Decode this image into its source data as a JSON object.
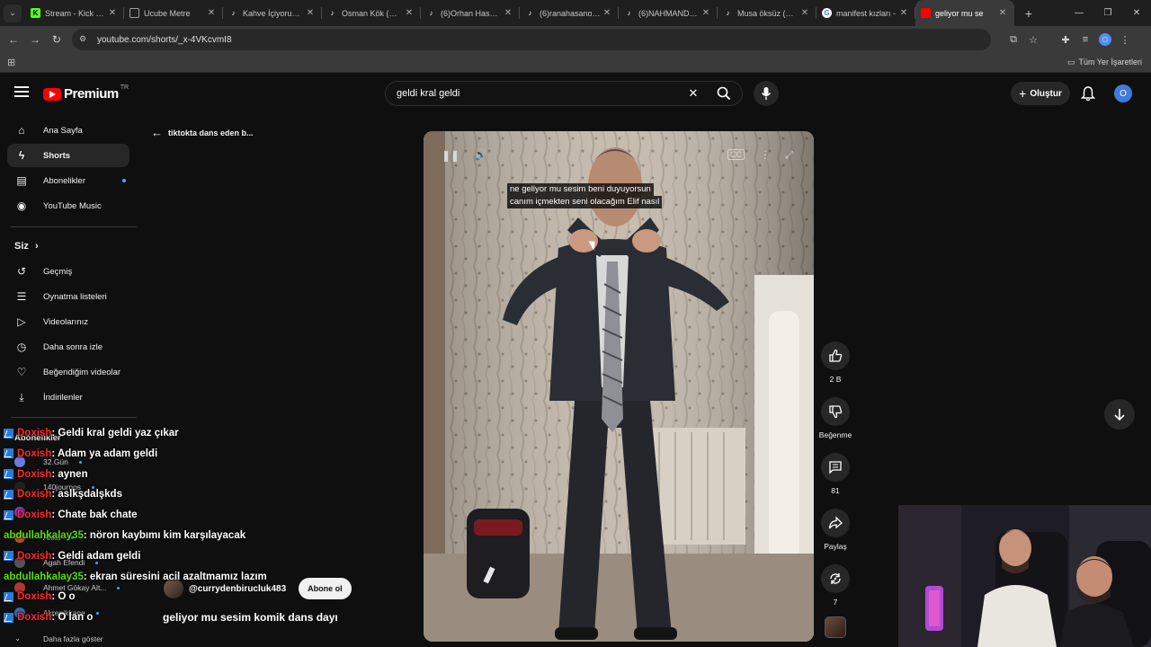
{
  "browser": {
    "tabs": [
      {
        "title": "Stream - Kick Dashboard",
        "favicon": "kick-icon",
        "color": "#53fc18"
      },
      {
        "title": "Ucube Metre",
        "favicon": "blank-page-icon",
        "color": "#9e9e9e"
      },
      {
        "title": "Kahve İçiyorum (@",
        "favicon": "tiktok-icon",
        "color": "#ffffff"
      },
      {
        "title": "Osman Kök (@mu",
        "favicon": "tiktok-icon",
        "color": "#ffffff"
      },
      {
        "title": "(6)Orhan Hasanov",
        "favicon": "tiktok-icon",
        "color": "#ffffff"
      },
      {
        "title": "(6)ranahasanova",
        "favicon": "tiktok-icon",
        "color": "#ffffff"
      },
      {
        "title": "(6)NAHMANDAYI",
        "favicon": "tiktok-icon",
        "color": "#ffffff"
      },
      {
        "title": "Musa öksüz (@fe",
        "favicon": "tiktok-icon",
        "color": "#ffffff"
      },
      {
        "title": "manifest kızları -",
        "favicon": "google-icon",
        "color": "#ffffff"
      },
      {
        "title": "geliyor mu se",
        "favicon": "youtube-icon",
        "color": "#ff0000",
        "active": true
      }
    ],
    "url": "youtube.com/shorts/_x-4VKcvmI8",
    "profile_initial": "O",
    "bookmarks_label": "Tüm Yer İşaretleri"
  },
  "youtube": {
    "logo_text": "Premium",
    "logo_country": "TR",
    "search_query": "geldi kral geldi",
    "create_label": "Oluştur",
    "avatar_initial": "O",
    "sidebar": {
      "main": [
        {
          "label": "Ana Sayfa",
          "icon": "home-icon"
        },
        {
          "label": "Shorts",
          "icon": "shorts-icon",
          "active": true
        },
        {
          "label": "Abonelikler",
          "icon": "subscriptions-icon",
          "dot": true
        },
        {
          "label": "YouTube Music",
          "icon": "music-icon"
        }
      ],
      "you_heading": "Siz",
      "you": [
        {
          "label": "Geçmiş",
          "icon": "history-icon"
        },
        {
          "label": "Oynatma listeleri",
          "icon": "playlist-icon"
        },
        {
          "label": "Videolarınız",
          "icon": "your-videos-icon"
        },
        {
          "label": "Daha sonra izle",
          "icon": "watch-later-icon"
        },
        {
          "label": "Beğendiğim videolar",
          "icon": "like-icon"
        },
        {
          "label": "İndirilenler",
          "icon": "download-icon"
        }
      ],
      "subscriptions_heading": "Abonelikler",
      "subscriptions": [
        "32.Gün",
        "140journos",
        "",
        "Anka",
        "Agah Efendi",
        "Ahmet Gökay Alt...",
        "Akrepikkane"
      ],
      "show_more": "Daha fazla göster"
    },
    "back_label": "tiktokta dans eden b...",
    "video": {
      "subtitle_line1": "ne geliyor mu sesim beni duyuyorsun",
      "subtitle_line2": "canım içmekten seni olacağım Elif nasıl"
    },
    "actions": {
      "likes": "2 B",
      "dislike_label": "Beğenme",
      "comments": "81",
      "share_label": "Paylaş",
      "remix_count": "7"
    },
    "channel_handle": "@currydenbirucluk483",
    "subscribe_label": "Abone ol",
    "short_title": "geliyor mu sesim komik dans dayı"
  },
  "chat": [
    {
      "user": "Doxish",
      "color": "#ff2b2b",
      "message": ": Geldi kral geldi yaz çıkar"
    },
    {
      "user": "Doxish",
      "color": "#ff2b2b",
      "message": ": Adam ya adam geldi"
    },
    {
      "user": "Doxish",
      "color": "#ff2b2b",
      "message": ": aynen"
    },
    {
      "user": "Doxish",
      "color": "#ff2b2b",
      "message": ": aslkşdalşkds"
    },
    {
      "user": "Doxish",
      "color": "#ff2b2b",
      "message": ": Chate bak chate"
    },
    {
      "user": "abdullahkalay35",
      "color": "#56e000",
      "message": ": nöron kaybımı kim karşılayacak",
      "no_badge": true
    },
    {
      "user": "Doxish",
      "color": "#ff2b2b",
      "message": ": Geldi adam geldi"
    },
    {
      "user": "abdullahkalay35",
      "color": "#56e000",
      "message": ": ekran süresini acil azaltmamız lazım",
      "no_badge": true
    },
    {
      "user": "Doxish",
      "color": "#ff2b2b",
      "message": ": O o"
    },
    {
      "user": "Doxish",
      "color": "#ff2b2b",
      "message": ": O lan o"
    }
  ]
}
